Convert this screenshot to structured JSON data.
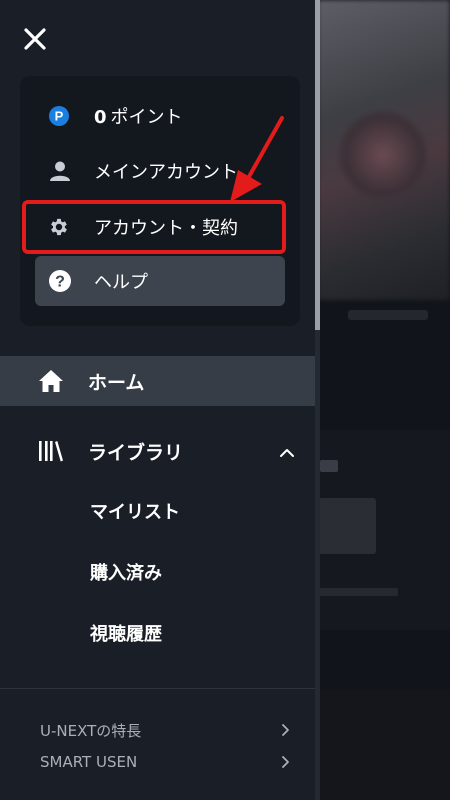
{
  "drawer": {
    "close_icon": "close-icon",
    "account_panel": {
      "points": {
        "value": "0",
        "label": "ポイント",
        "icon": "points-p-icon",
        "icon_color": "#1a7fe0"
      },
      "main_account": {
        "label": "メインアカウント",
        "icon": "person-icon"
      },
      "account_contract": {
        "label": "アカウント・契約",
        "icon": "gear-icon"
      },
      "help": {
        "label": "ヘルプ",
        "icon": "help-circle-icon"
      }
    },
    "nav": {
      "home": {
        "label": "ホーム",
        "icon": "home-icon"
      },
      "library": {
        "label": "ライブラリ",
        "icon": "library-icon",
        "expanded_icon": "chevron-up-icon",
        "children": [
          {
            "label": "マイリスト"
          },
          {
            "label": "購入済み"
          },
          {
            "label": "視聴履歴"
          }
        ]
      }
    },
    "footer": [
      {
        "label": "U-NEXTの特長"
      },
      {
        "label": "SMART USEN"
      }
    ]
  },
  "annotation": {
    "highlight_color": "#e41b1b"
  },
  "colors": {
    "drawer_bg": "#1a1f27",
    "panel_bg": "#13171e",
    "selected_bg": "#363d47",
    "help_bg": "#3d444d"
  }
}
